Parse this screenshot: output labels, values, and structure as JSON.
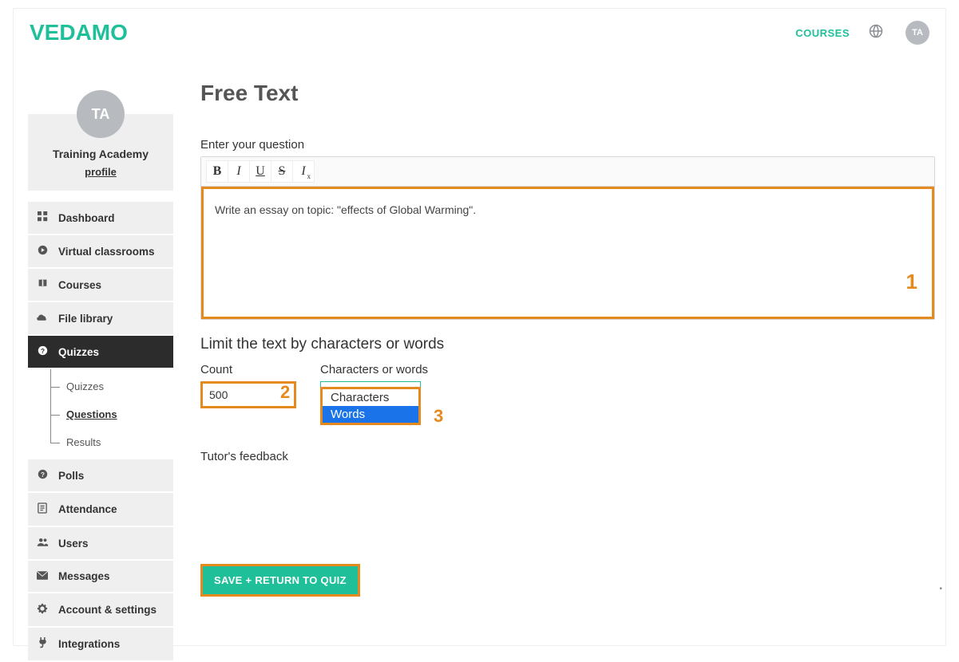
{
  "header": {
    "logo": "VEDAMO",
    "nav_courses": "COURSES",
    "avatar_initials": "TA"
  },
  "profile": {
    "avatar_initials": "TA",
    "org_name": "Training Academy",
    "profile_link": "profile"
  },
  "sidebar": {
    "dashboard": "Dashboard",
    "virtual_classrooms": "Virtual classrooms",
    "courses": "Courses",
    "file_library": "File library",
    "quizzes": "Quizzes",
    "quizzes_sub_quizzes": "Quizzes",
    "quizzes_sub_questions": "Questions",
    "quizzes_sub_results": "Results",
    "polls": "Polls",
    "attendance": "Attendance",
    "users": "Users",
    "messages": "Messages",
    "account_settings": "Account & settings",
    "integrations": "Integrations"
  },
  "main": {
    "page_title": "Free Text",
    "enter_question_label": "Enter your question",
    "question_text": "Write an essay on topic: \"effects of Global Warming\".",
    "limit_section_title": "Limit the text by characters or words",
    "count_label": "Count",
    "count_value": "500",
    "chars_words_label": "Characters or words",
    "select_visible": "Words",
    "dropdown_opt_chars": "Characters",
    "dropdown_opt_words": "Words",
    "feedback_label": "Tutor's feedback",
    "save_button": "SAVE + RETURN TO QUIZ",
    "annot1": "1",
    "annot2": "2",
    "annot3": "3"
  }
}
